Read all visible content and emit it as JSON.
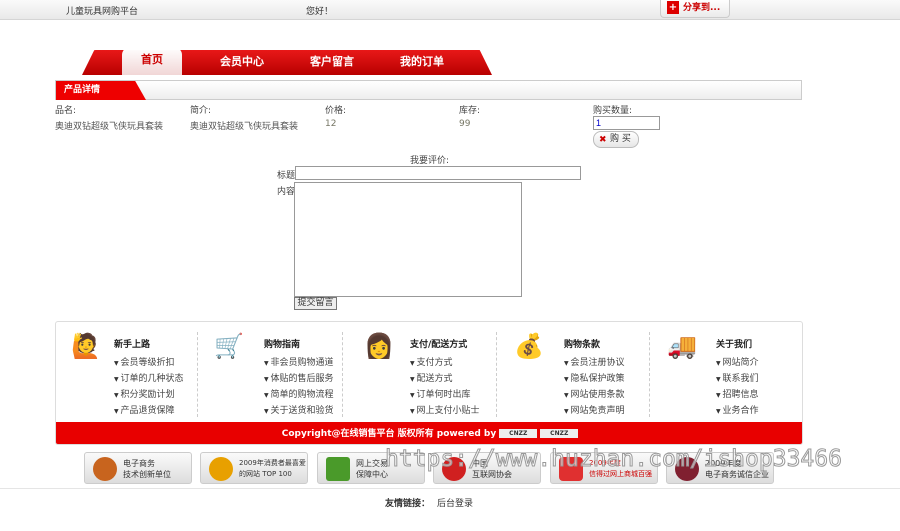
{
  "topbar": {
    "site_name": "儿童玩具网购平台",
    "greeting": "您好！",
    "share_label": "分享到..."
  },
  "nav": {
    "tabs": [
      {
        "label": "首页"
      },
      {
        "label": "会员中心"
      },
      {
        "label": "客户留言"
      },
      {
        "label": "我的订单"
      }
    ]
  },
  "section_title": "产品详情",
  "product": {
    "headers": {
      "name": "品名:",
      "intro": "简介:",
      "price": "价格:",
      "stock": "库存:",
      "qty": "购买数量:"
    },
    "name": "奥迪双钻超级飞侠玩具套装",
    "intro": "奥迪双钻超级飞侠玩具套装",
    "price": "12",
    "stock": "99",
    "qty_value": "1",
    "buy_label": "购 买"
  },
  "review": {
    "heading": "我要评价:",
    "title_label": "标题",
    "content_label": "内容",
    "submit_label": "提交留言"
  },
  "footer": {
    "columns": [
      {
        "title": "新手上路",
        "icon": "customer-service-icon",
        "items": [
          "会员等级折扣",
          "订单的几种状态",
          "积分奖励计划",
          "产品退货保障"
        ]
      },
      {
        "title": "购物指南",
        "icon": "shopping-cart-icon",
        "items": [
          "非会员购物通道",
          "体贴的售后服务",
          "简单的购物流程",
          "关于送货和验货"
        ]
      },
      {
        "title": "支付/配送方式",
        "icon": "headset-agent-icon",
        "items": [
          "支付方式",
          "配送方式",
          "订单何时出库",
          "网上支付小贴士"
        ]
      },
      {
        "title": "购物条款",
        "icon": "money-bag-icon",
        "items": [
          "会员注册协议",
          "隐私保护政策",
          "网站使用条款",
          "网站免责声明"
        ]
      },
      {
        "title": "关于我们",
        "icon": "truck-icon",
        "items": [
          "网站简介",
          "联系我们",
          "招聘信息",
          "业务合作"
        ]
      }
    ],
    "copyright": "Copyright@在线销售平台 版权所有 powered by",
    "cnzz": [
      "CNZZ",
      "CNZZ"
    ]
  },
  "badges": [
    {
      "l1": "电子商务",
      "l2": "技术创新单位",
      "color": "#c8641e"
    },
    {
      "l1": "2009年消费者最喜爱",
      "l2": "的网站 TOP 100",
      "color": "#e8a000"
    },
    {
      "l1": "网上交易",
      "l2": "保障中心",
      "color": "#4a9a2a"
    },
    {
      "l1": "中国",
      "l2": "互联网协会",
      "color": "#d02020"
    },
    {
      "l1": "2009年度",
      "l2": "信得过网上商城百强",
      "color": "#e03030"
    },
    {
      "l1": "2009年度",
      "l2": "电子商务诚信企业",
      "color": "#802030"
    }
  ],
  "links": {
    "label": "友情链接：",
    "items": [
      "后台登录"
    ]
  },
  "watermark": "https://www.huzhan.com/ishop33466"
}
